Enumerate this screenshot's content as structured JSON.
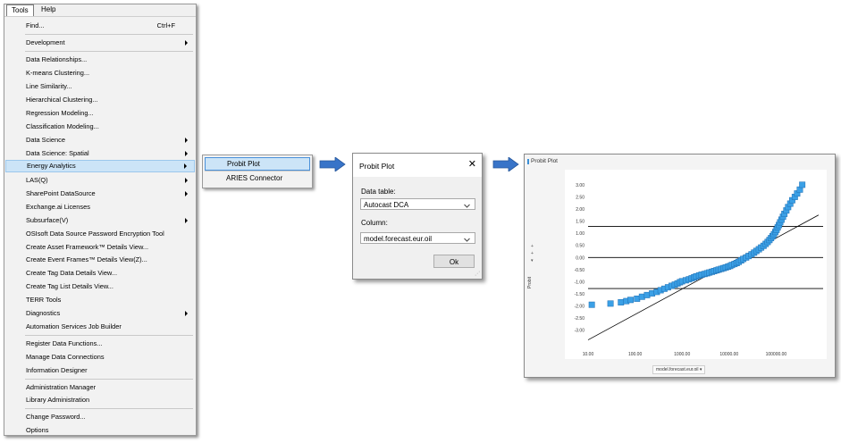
{
  "menubar": {
    "tools_label": "Tools",
    "help_label": "Help"
  },
  "menu": {
    "find_label": "Find...",
    "find_shortcut": "Ctrl+F",
    "development_label": "Development",
    "items": [
      "Data Relationships...",
      "K-means Clustering...",
      "Line Similarity...",
      "Hierarchical Clustering...",
      "Regression Modeling...",
      "Classification Modeling...",
      "Data Science",
      "Data Science: Spatial",
      "Energy Analytics",
      "LAS(Q)",
      "SharePoint DataSource",
      "Exchange.ai Licenses",
      "Subsurface(V)",
      "OSIsoft Data Source Password Encryption Tool",
      "Create Asset Framework™ Details View...",
      "Create Event Frames™ Details View(Z)...",
      "Create Tag Data Details View...",
      "Create Tag List Details View...",
      "TERR Tools",
      "Diagnostics",
      "Automation Services Job Builder"
    ],
    "group2": [
      "Register Data Functions...",
      "Manage Data Connections",
      "Information Designer"
    ],
    "group3": [
      "Administration Manager",
      "Library Administration"
    ],
    "group4": [
      "Change Password...",
      "Options"
    ]
  },
  "submenu": {
    "items": [
      "Probit Plot",
      "ARIES Connector"
    ]
  },
  "dialog": {
    "title": "Probit Plot",
    "close_glyph": "✕",
    "data_table_label": "Data table:",
    "data_table_value": "Autocast DCA",
    "column_label": "Column:",
    "column_value": "model.forecast.eur.oil",
    "ok_label": "Ok"
  },
  "plot": {
    "title": "Probit Plot",
    "ylabel": "Probit",
    "ctrl_plus": "+",
    "ctrl_plus2": "+",
    "ctrl_arrow": "▾",
    "xlabel": "model.forecast.eur.oil ▾"
  },
  "colors": {
    "accent": "#2e8fd8",
    "marker": "#3ba0e6",
    "menu_highlight": "#cce4f7"
  },
  "chart_data": {
    "type": "scatter",
    "x_scale": "log",
    "xlim": [
      10,
      1000000
    ],
    "ylim": [
      -3.6,
      3.4
    ],
    "x_tick_labels": [
      "10.00",
      "100.00",
      "1000.00",
      "10000.00",
      "100000.00"
    ],
    "x_ticks": [
      10,
      100,
      1000,
      10000,
      100000
    ],
    "y_ticks": [
      3.0,
      2.5,
      2.0,
      1.5,
      1.0,
      0.5,
      0.0,
      -0.5,
      -1.0,
      -1.5,
      -2.0,
      -2.5,
      -3.0
    ],
    "y_tick_labels": [
      "3.00",
      "2.50",
      "2.00",
      "1.50",
      "1.00",
      "0.50",
      "0.00",
      "-0.50",
      "-1.00",
      "-1.50",
      "-2.00",
      "-2.50",
      "-3.00"
    ],
    "reference_lines_y": [
      1.28,
      0.0,
      -1.28
    ],
    "fit_line": {
      "x": [
        10,
        800000
      ],
      "y": [
        -3.4,
        1.75
      ]
    },
    "points": {
      "x": [
        12,
        30,
        50,
        65,
        80,
        110,
        140,
        180,
        230,
        290,
        350,
        420,
        500,
        600,
        700,
        800,
        900,
        1000,
        1200,
        1400,
        1600,
        1800,
        2000,
        2300,
        2600,
        3000,
        3400,
        3800,
        4300,
        4800,
        5400,
        6000,
        6800,
        7600,
        8500,
        9500,
        10500,
        11500,
        13000,
        14500,
        16000,
        18000,
        20000,
        23000,
        26000,
        30000,
        34000,
        38000,
        43000,
        48000,
        54000,
        60000,
        66000,
        72000,
        78000,
        84000,
        90000,
        96000,
        102000,
        108000,
        115000,
        122000,
        130000,
        140000,
        150000,
        165000,
        180000,
        200000,
        220000,
        250000,
        280000,
        320000,
        360000
      ],
      "y": [
        -1.95,
        -1.9,
        -1.85,
        -1.8,
        -1.75,
        -1.7,
        -1.62,
        -1.55,
        -1.48,
        -1.42,
        -1.35,
        -1.29,
        -1.23,
        -1.17,
        -1.12,
        -1.07,
        -1.02,
        -0.98,
        -0.94,
        -0.9,
        -0.86,
        -0.82,
        -0.78,
        -0.74,
        -0.71,
        -0.68,
        -0.65,
        -0.62,
        -0.59,
        -0.56,
        -0.53,
        -0.5,
        -0.47,
        -0.44,
        -0.41,
        -0.38,
        -0.35,
        -0.31,
        -0.27,
        -0.23,
        -0.18,
        -0.12,
        -0.06,
        0.0,
        0.06,
        0.13,
        0.2,
        0.27,
        0.34,
        0.41,
        0.48,
        0.56,
        0.64,
        0.72,
        0.8,
        0.88,
        0.96,
        1.05,
        1.14,
        1.24,
        1.34,
        1.45,
        1.56,
        1.68,
        1.8,
        1.94,
        2.08,
        2.22,
        2.36,
        2.5,
        2.64,
        2.8,
        3.0
      ]
    }
  }
}
